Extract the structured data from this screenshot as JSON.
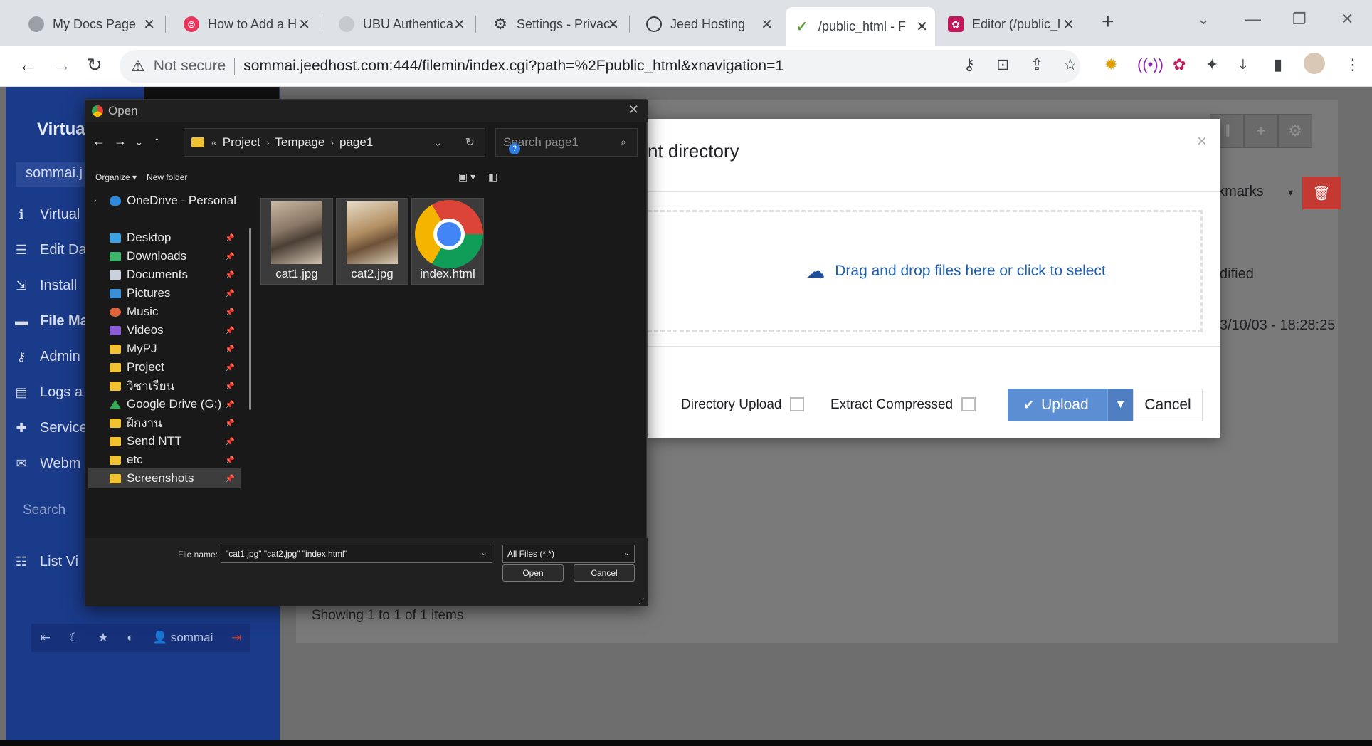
{
  "browser": {
    "tabs": [
      {
        "title": "My Docs Page",
        "fav_color": "#9aa0a6",
        "active": false
      },
      {
        "title": "How to Add a H",
        "fav_color": "#e8365d",
        "active": false
      },
      {
        "title": "UBU Authentica",
        "fav_color": "#9aa0a6",
        "active": false
      },
      {
        "title": "Settings - Privac",
        "fav_color": "#3c4043",
        "active": false
      },
      {
        "title": "Jeed Hosting",
        "fav_color": "#3c4043",
        "active": false
      },
      {
        "title": "/public_html - F",
        "fav_color": "#5aa02c",
        "active": true
      },
      {
        "title": "Editor (/public_l",
        "fav_color": "#c2185b",
        "active": false
      }
    ],
    "not_secure": "Not secure",
    "url": "sommai.jeedhost.com:444/filemin/index.cgi?path=%2Fpublic_html&xnavigation=1"
  },
  "sidebar": {
    "title": "Virtual",
    "host": "sommai.j",
    "items": [
      {
        "label": "Virtual",
        "icon": "info-icon"
      },
      {
        "label": "Edit Da",
        "icon": "database-icon"
      },
      {
        "label": "Install",
        "icon": "install-icon"
      },
      {
        "label": "File Ma",
        "icon": "folder-icon"
      },
      {
        "label": "Admin",
        "icon": "key-icon"
      },
      {
        "label": "Logs a",
        "icon": "file-icon"
      },
      {
        "label": "Service",
        "icon": "puzzle-icon"
      },
      {
        "label": "Webm",
        "icon": "webmail-icon"
      },
      {
        "label": "List Vi",
        "icon": "list-icon"
      }
    ],
    "search": "Search",
    "user": "sommai"
  },
  "filemin": {
    "showing": "Showing 1 to 1 of 1 items",
    "bookmarks": "okmarks",
    "modified_header": "dified",
    "modified_value": "3/10/03 - 18:28:25"
  },
  "upload_modal": {
    "title": "nt directory",
    "dropzone_text": "Drag and drop files here or click to select",
    "directory_upload": "Directory Upload",
    "extract_compressed": "Extract Compressed",
    "upload_label": "Upload",
    "cancel_label": "Cancel"
  },
  "open_dialog": {
    "title": "Open",
    "path": [
      "Project",
      "Tempage",
      "page1"
    ],
    "search_placeholder": "Search page1",
    "organize": "Organize",
    "new_folder": "New folder",
    "tree": [
      {
        "label": "OneDrive - Personal",
        "color": "#2e8ad8",
        "pinned": false
      },
      {
        "label": "Desktop",
        "color": "#3ea0e0",
        "pinned": true
      },
      {
        "label": "Downloads",
        "color": "#3fb56b",
        "pinned": true
      },
      {
        "label": "Documents",
        "color": "#c9d2dc",
        "pinned": true
      },
      {
        "label": "Pictures",
        "color": "#3b8fd6",
        "pinned": true
      },
      {
        "label": "Music",
        "color": "#e0643c",
        "pinned": true
      },
      {
        "label": "Videos",
        "color": "#8a5cd6",
        "pinned": true
      },
      {
        "label": "MyPJ",
        "color": "#f1c232",
        "pinned": true
      },
      {
        "label": "Project",
        "color": "#f1c232",
        "pinned": true
      },
      {
        "label": "วิชาเรียน",
        "color": "#f1c232",
        "pinned": true
      },
      {
        "label": "Google Drive (G:)",
        "color": "#34a853",
        "pinned": true
      },
      {
        "label": "ฝึกงาน",
        "color": "#f1c232",
        "pinned": true
      },
      {
        "label": "Send NTT",
        "color": "#f1c232",
        "pinned": true
      },
      {
        "label": "etc",
        "color": "#f1c232",
        "pinned": true
      },
      {
        "label": "Screenshots",
        "color": "#f1c232",
        "pinned": true
      }
    ],
    "files": [
      {
        "name": "cat1.jpg",
        "kind": "image"
      },
      {
        "name": "cat2.jpg",
        "kind": "image"
      },
      {
        "name": "index.html",
        "kind": "chrome-html"
      }
    ],
    "file_name_label": "File name:",
    "file_name_value": "\"cat1.jpg\" \"cat2.jpg\" \"index.html\"",
    "file_type": "All Files (*.*)",
    "open_label": "Open",
    "cancel_label": "Cancel"
  }
}
